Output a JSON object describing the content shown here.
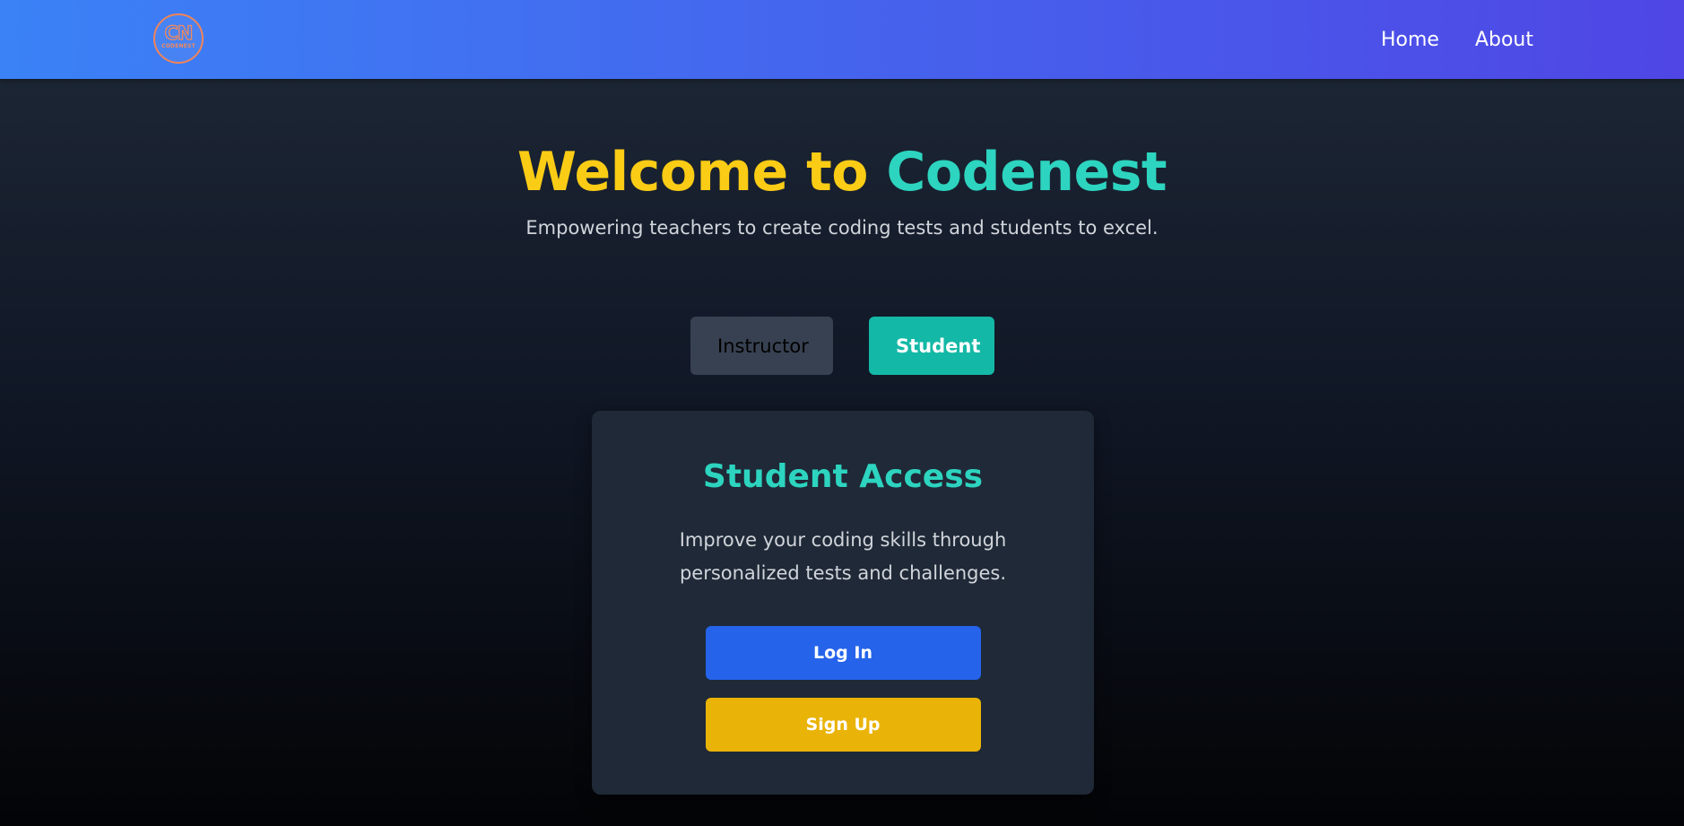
{
  "navbar": {
    "logo": {
      "mark": "CN",
      "sub": "CODENEST",
      "accent_color": "#f08a5d"
    },
    "links": [
      {
        "label": "Home"
      },
      {
        "label": "About"
      }
    ],
    "gradient_colors": [
      "#3b82f6",
      "#4f46e5"
    ]
  },
  "hero": {
    "title_part1": "Welcome to",
    "title_part2": "Codenest",
    "subtitle": "Empowering teachers to create coding tests and students to excel.",
    "colors": {
      "title_part1": "#facc15",
      "title_part2": "#2dd4bf"
    }
  },
  "role_toggle": {
    "options": [
      {
        "label": "Instructor",
        "selected": false
      },
      {
        "label": "Student",
        "selected": true
      }
    ]
  },
  "card": {
    "title": "Student Access",
    "description": "Improve your coding skills through personalized tests and challenges.",
    "login_label": "Log In",
    "signup_label": "Sign Up",
    "colors": {
      "login": "#2563eb",
      "signup": "#eab308",
      "title": "#2dd4bf"
    }
  }
}
